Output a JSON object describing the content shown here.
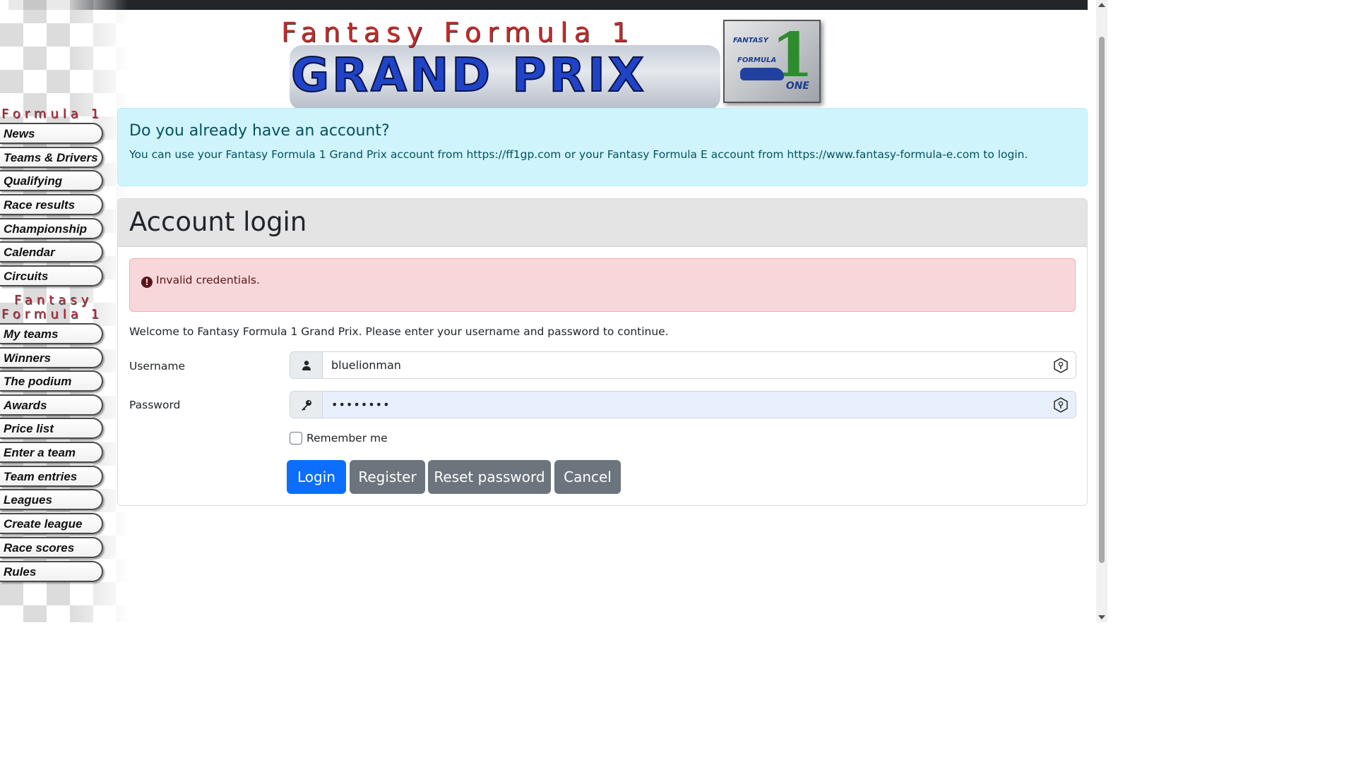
{
  "banner": {
    "top_text": "Fantasy Formula 1",
    "main_text": "GRAND PRIX",
    "badge_line1": "FANTASY",
    "badge_line2": "FORMULA",
    "badge_number": "1",
    "badge_line3": "ONE"
  },
  "sidebar": {
    "section1_title": "Formula 1",
    "section1_items": [
      "News",
      "Teams & Drivers",
      "Qualifying",
      "Race results",
      "Championship",
      "Calendar",
      "Circuits"
    ],
    "section2_title_line1": "Fantasy",
    "section2_title_line2": "Formula 1",
    "section2_items": [
      "My teams",
      "Winners",
      "The podium",
      "Awards",
      "Price list",
      "Enter a team",
      "Team entries",
      "Leagues",
      "Create league",
      "Race scores",
      "Rules"
    ]
  },
  "info": {
    "title": "Do you already have an account?",
    "text": "You can use your Fantasy Formula 1 Grand Prix account from https://ff1gp.com or your Fantasy Formula E account from https://www.fantasy-formula-e.com to login."
  },
  "login": {
    "title": "Account login",
    "alert": "Invalid credentials.",
    "welcome": "Welcome to Fantasy Formula 1 Grand Prix. Please enter your username and password to continue.",
    "username_label": "Username",
    "username_value": "bluelionman",
    "password_label": "Password",
    "password_value": "••••••••",
    "remember_label": "Remember me",
    "buttons": {
      "login": "Login",
      "register": "Register",
      "reset": "Reset password",
      "cancel": "Cancel"
    }
  },
  "colors": {
    "primary": "#0d6efd",
    "secondary": "#6c757d",
    "info_bg": "#cff4fc",
    "danger_bg": "#f8d7da",
    "sidebar_heading": "#b0293a"
  },
  "icons": {
    "username_addon": "user-icon",
    "password_addon": "key-icon",
    "field_password_manager": "password-manager-icon",
    "alert": "exclamation-circle-icon"
  }
}
